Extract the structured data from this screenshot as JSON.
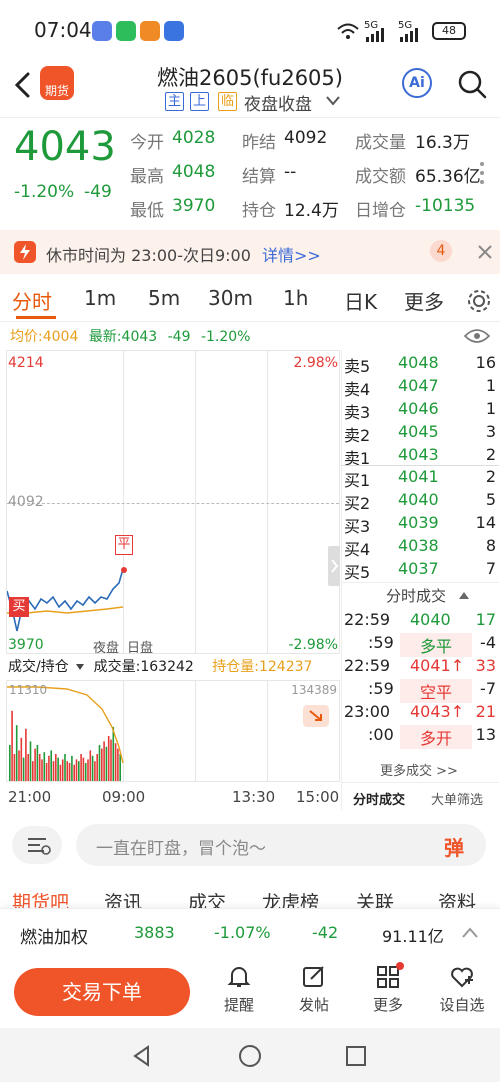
{
  "status_bar": {
    "time": "07:04",
    "net1": "5G",
    "net2": "5G",
    "battery": "48"
  },
  "header": {
    "title": "燃油2605(fu2605)",
    "tags": [
      "主",
      "上",
      "临"
    ],
    "session": "夜盘收盘",
    "ai_label": "Ai"
  },
  "quote": {
    "price": "4043",
    "change_pct": "-1.20%",
    "change": "-49",
    "fields": [
      {
        "label": "今开",
        "value": "4028"
      },
      {
        "label": "昨结",
        "value": "4092"
      },
      {
        "label": "成交量",
        "value": "16.3万"
      },
      {
        "label": "最高",
        "value": "4048"
      },
      {
        "label": "结算",
        "value": "--"
      },
      {
        "label": "成交额",
        "value": "65.36亿"
      },
      {
        "label": "最低",
        "value": "3970"
      },
      {
        "label": "持仓",
        "value": "12.4万"
      },
      {
        "label": "日增仓",
        "value": "-10135"
      }
    ]
  },
  "notice": {
    "text": "休市时间为 23:00-次日9:00",
    "link": "详情>>",
    "badge": "4"
  },
  "tabs": [
    "分时",
    "1m",
    "5m",
    "30m",
    "1h",
    "日K",
    "更多"
  ],
  "chart_info": {
    "avg": "均价:4004",
    "latest_label": "最新:",
    "latest": "4043",
    "chg": "-49",
    "pct": "-1.20%"
  },
  "chart": {
    "y_top": "4214",
    "y_mid": "4092",
    "y_bot": "3970",
    "pct_top": "2.98%",
    "pct_bot": "-2.98%",
    "night_label": "夜盘",
    "day_label": "日盘",
    "buy_marker": "买",
    "flat_marker": "平",
    "vol_label": "成交/持仓",
    "vol_value_label": "成交量:163242",
    "oi_value_label": "持仓量:124237",
    "vol_top": "11310",
    "oi_top": "134389",
    "times": [
      "21:00",
      "09:00",
      "13:30",
      "15:00"
    ]
  },
  "orderbook": {
    "asks": [
      {
        "label": "卖5",
        "price": "4048",
        "qty": "16"
      },
      {
        "label": "卖4",
        "price": "4047",
        "qty": "1"
      },
      {
        "label": "卖3",
        "price": "4046",
        "qty": "1"
      },
      {
        "label": "卖2",
        "price": "4045",
        "qty": "3"
      },
      {
        "label": "卖1",
        "price": "4043",
        "qty": "2"
      }
    ],
    "bids": [
      {
        "label": "买1",
        "price": "4041",
        "qty": "2"
      },
      {
        "label": "买2",
        "price": "4040",
        "qty": "5"
      },
      {
        "label": "买3",
        "price": "4039",
        "qty": "14"
      },
      {
        "label": "买4",
        "price": "4038",
        "qty": "8"
      },
      {
        "label": "买5",
        "price": "4037",
        "qty": "7"
      }
    ]
  },
  "trades": {
    "title": "分时成交",
    "rows": [
      {
        "time": "22:59",
        "price": "4040",
        "price_arrow": "",
        "qty": "17",
        "sec": ":59",
        "type": "多平",
        "oi": "-4"
      },
      {
        "time": "22:59",
        "price": "4041",
        "price_arrow": "↑",
        "qty": "33",
        "sec": ":59",
        "type": "空平",
        "oi": "-7"
      },
      {
        "time": "23:00",
        "price": "4043",
        "price_arrow": "↑",
        "qty": "21",
        "sec": ":00",
        "type": "多开",
        "oi": "13"
      }
    ],
    "more": "更多成交 >>",
    "tab1": "分时成交",
    "tab2": "大单筛选"
  },
  "input": {
    "placeholder": "一直在盯盘，冒个泡～",
    "send": "弹"
  },
  "subtabs": [
    "期货吧",
    "资讯",
    "成交",
    "龙虎榜",
    "关联",
    "资料"
  ],
  "index_row": {
    "name": "燃油加权",
    "price": "3883",
    "pct": "-1.07%",
    "chg": "-42",
    "amount": "91.11亿"
  },
  "bottom_bar": {
    "trade_button": "交易下单",
    "items": [
      "提醒",
      "发帖",
      "更多",
      "设自选"
    ]
  },
  "colors": {
    "up": "#e53935",
    "down": "#1e9a3a",
    "accent": "#f0552a",
    "link": "#3b6bd6"
  }
}
